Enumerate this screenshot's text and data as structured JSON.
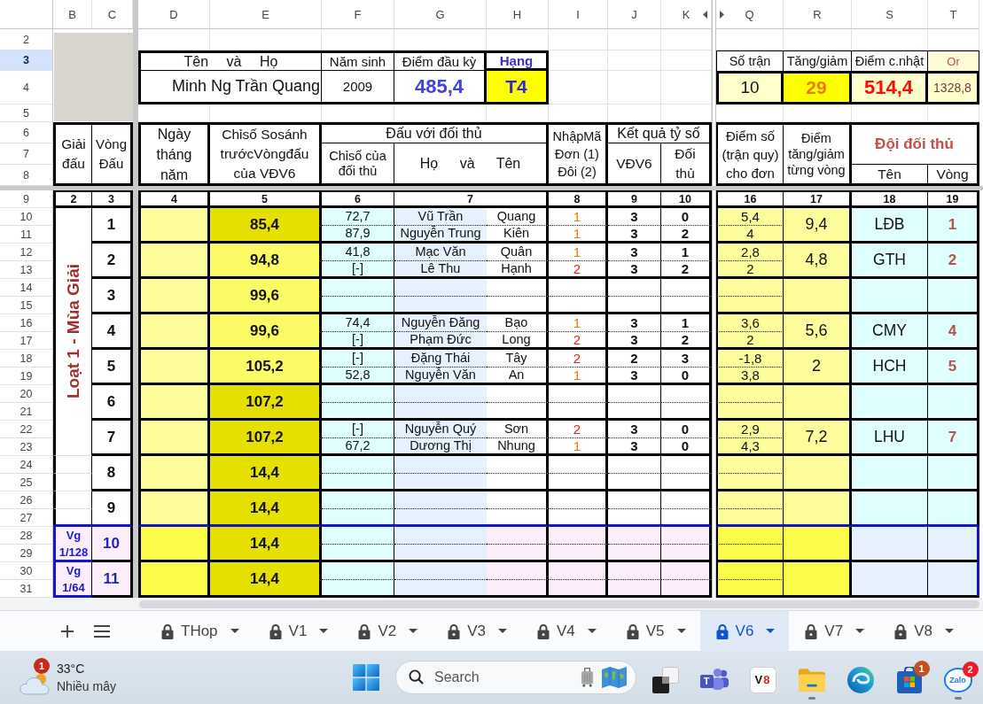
{
  "sheet": {
    "column_headers": [
      "B",
      "C",
      "D",
      "E",
      "F",
      "G",
      "H",
      "I",
      "J",
      "K",
      "Q",
      "R",
      "S",
      "T"
    ],
    "row_headers": [
      {
        "label": "2",
        "selected": false
      },
      {
        "label": "3",
        "selected": true
      },
      {
        "label": "4",
        "selected": false
      },
      {
        "label": "5",
        "selected": false
      },
      {
        "label": "6",
        "selected": false
      },
      {
        "label": "7",
        "selected": false
      },
      {
        "label": "8",
        "selected": false
      },
      {
        "label": "9",
        "selected": false
      },
      {
        "label": "10",
        "selected": false
      },
      {
        "label": "11",
        "selected": false
      },
      {
        "label": "12",
        "selected": false
      },
      {
        "label": "13",
        "selected": false
      },
      {
        "label": "14",
        "selected": false
      },
      {
        "label": "15",
        "selected": false
      },
      {
        "label": "16",
        "selected": false
      },
      {
        "label": "17",
        "selected": false
      },
      {
        "label": "18",
        "selected": false
      },
      {
        "label": "19",
        "selected": false
      },
      {
        "label": "20",
        "selected": false
      },
      {
        "label": "21",
        "selected": false
      },
      {
        "label": "22",
        "selected": false
      },
      {
        "label": "23",
        "selected": false
      },
      {
        "label": "24",
        "selected": false
      },
      {
        "label": "25",
        "selected": false
      },
      {
        "label": "26",
        "selected": false
      },
      {
        "label": "27",
        "selected": false
      },
      {
        "label": "28",
        "selected": false
      },
      {
        "label": "29",
        "selected": false
      },
      {
        "label": "30",
        "selected": false
      },
      {
        "label": "31",
        "selected": false
      }
    ],
    "profile": {
      "name_label": "Tên và Họ",
      "name": "Minh Ng Trần Quang",
      "birth_year_label": "Năm sinh",
      "birth_year": "2009",
      "start_score_label": "Điểm đầu kỳ",
      "start_score": "485,4",
      "rank_label": "Hạng",
      "rank": "T4"
    },
    "summary": [
      {
        "label": "Số trận",
        "value": "10"
      },
      {
        "label": "Tăng/giảm",
        "value": "29"
      },
      {
        "label": "Điểm c.nhật",
        "value": "514,4"
      },
      {
        "label": "Or",
        "value": "1328,8"
      }
    ],
    "headers": {
      "tournament": "Giải\nđấu",
      "round": "Vòng\nĐấu",
      "date": "Ngày\ntháng\nnăm",
      "index": "Chỉsố Sosánh\ntrướcVòngđấu\ncủa VĐV6",
      "opponent_group": "Đấu với đối thủ",
      "opponent_index": "Chỉsố của\nđối thủ",
      "opponent_name": "Họ và Tên",
      "match_code": "NhậpMã\nĐơn (1)\nĐôi (2)",
      "score_group": "Kết quả tỷ số",
      "score_player": "VĐV6",
      "score_opponent": "Đối\nthủ",
      "points": "Điểm số\n(trận quy)\ncho đơn",
      "change": "Điểm\ntăng/giảm\ntừng vòng",
      "team_group": "Đội đối thủ",
      "team_name": "Tên",
      "team_round": "Vòng"
    },
    "column_numbers": [
      "2",
      "3",
      "4",
      "5",
      "6",
      "7",
      "8",
      "9",
      "10",
      "16",
      "17",
      "18",
      "19"
    ],
    "groups": [
      {
        "kind": "series",
        "label": "Loạt 1 - Mùa Giải",
        "rounds": [
          {
            "number": "1",
            "index": "85,4",
            "color": "#e6e000",
            "matches": [
              {
                "kind": "singles",
                "opponent_index": "72,7",
                "surname": "Vũ Trần",
                "given_name": "Quang",
                "code": "1",
                "player_score": "3",
                "opponent_score": "0",
                "points": "5,4"
              },
              {
                "kind": "singles",
                "opponent_index": "87,9",
                "surname": "Nguyễn Trung",
                "given_name": "Kiên",
                "code": "1",
                "player_score": "3",
                "opponent_score": "2",
                "points": "4"
              }
            ],
            "change": "9,4",
            "team": "LĐB",
            "team_round": "1"
          },
          {
            "number": "2",
            "index": "94,8",
            "color": "#fbfb66",
            "matches": [
              {
                "kind": "singles",
                "opponent_index": "41,8",
                "surname": "Mạc Văn",
                "given_name": "Quân",
                "code": "1",
                "player_score": "3",
                "opponent_score": "1",
                "points": "2,8"
              },
              {
                "kind": "doubles",
                "opponent_index": "[-]",
                "surname": "Lê Thu",
                "given_name": "Hạnh",
                "code": "2",
                "player_score": "3",
                "opponent_score": "2",
                "points": "2"
              }
            ],
            "change": "4,8",
            "team": "GTH",
            "team_round": "2"
          },
          {
            "number": "3",
            "index": "99,6",
            "color": "#fbfb66"
          },
          {
            "number": "4",
            "index": "99,6",
            "color": "#fbfb66",
            "matches": [
              {
                "kind": "singles",
                "opponent_index": "74,4",
                "surname": "Nguyễn Đăng",
                "given_name": "Bạo",
                "code": "1",
                "player_score": "3",
                "opponent_score": "1",
                "points": "3,6"
              },
              {
                "kind": "doubles",
                "opponent_index": "[-]",
                "surname": "Phạm Đức",
                "given_name": "Long",
                "code": "2",
                "player_score": "3",
                "opponent_score": "2",
                "points": "2"
              }
            ],
            "change": "5,6",
            "team": "CMY",
            "team_round": "4"
          },
          {
            "number": "5",
            "index": "105,2",
            "color": "#fbfb66",
            "matches": [
              {
                "kind": "doubles",
                "opponent_index": "[-]",
                "surname": "Đặng Thái",
                "given_name": "Tây",
                "code": "2",
                "player_score": "2",
                "opponent_score": "3",
                "points": "-1,8"
              },
              {
                "kind": "singles",
                "opponent_index": "52,8",
                "surname": "Nguyễn Văn",
                "given_name": "An",
                "code": "1",
                "player_score": "3",
                "opponent_score": "0",
                "points": "3,8"
              }
            ],
            "change": "2",
            "team": "HCH",
            "team_round": "5"
          },
          {
            "number": "6",
            "index": "107,2",
            "color": "#e6e000"
          },
          {
            "number": "7",
            "index": "107,2",
            "color": "#e6e000",
            "matches": [
              {
                "kind": "doubles",
                "opponent_index": "[-]",
                "surname": "Nguyễn Quý",
                "given_name": "Sơn",
                "code": "2",
                "player_score": "3",
                "opponent_score": "0",
                "points": "2,9"
              },
              {
                "kind": "singles",
                "opponent_index": "67,2",
                "surname": "Dương Thị",
                "given_name": "Nhung",
                "code": "1",
                "player_score": "3",
                "opponent_score": "0",
                "points": "4,3"
              }
            ],
            "change": "7,2",
            "team": "LHU",
            "team_round": "7"
          }
        ]
      },
      {
        "kind": "series",
        "rounds": [
          {
            "number": "8",
            "index": "14,4",
            "color": "#e6e000"
          },
          {
            "number": "9",
            "index": "14,4",
            "color": "#e6e000"
          }
        ]
      },
      {
        "kind": "knockout",
        "label": "Vg 1/128",
        "rounds": [
          {
            "number": "10",
            "index": "14,4",
            "color": "#e6e000"
          }
        ]
      },
      {
        "kind": "knockout",
        "label": "Vg 1/64",
        "rounds": [
          {
            "number": "11",
            "index": "14,4",
            "color": "#e6e000"
          }
        ]
      }
    ]
  },
  "sheet_tabs": [
    {
      "label": "THop",
      "selected": false
    },
    {
      "label": "V1",
      "selected": false
    },
    {
      "label": "V2",
      "selected": false
    },
    {
      "label": "V3",
      "selected": false
    },
    {
      "label": "V4",
      "selected": false
    },
    {
      "label": "V5",
      "selected": false
    },
    {
      "label": "V6",
      "selected": true
    },
    {
      "label": "V7",
      "selected": false
    },
    {
      "label": "V8",
      "selected": false
    }
  ],
  "taskbar": {
    "weather": {
      "temperature": "33°C",
      "condition": "Nhiều mây",
      "badge": "1"
    },
    "search": {
      "placeholder": "Search"
    },
    "apps": [
      {
        "kind": "squares",
        "running": false
      },
      {
        "kind": "teams",
        "label": "T",
        "running": false
      },
      {
        "kind": "v8",
        "label": "V8",
        "running": false
      },
      {
        "kind": "explorer",
        "running": true
      },
      {
        "kind": "edge",
        "running": false
      },
      {
        "kind": "store",
        "badge": "1",
        "running": false
      },
      {
        "kind": "zalo",
        "label": "Zalo",
        "badge": "2",
        "running": true
      }
    ]
  }
}
